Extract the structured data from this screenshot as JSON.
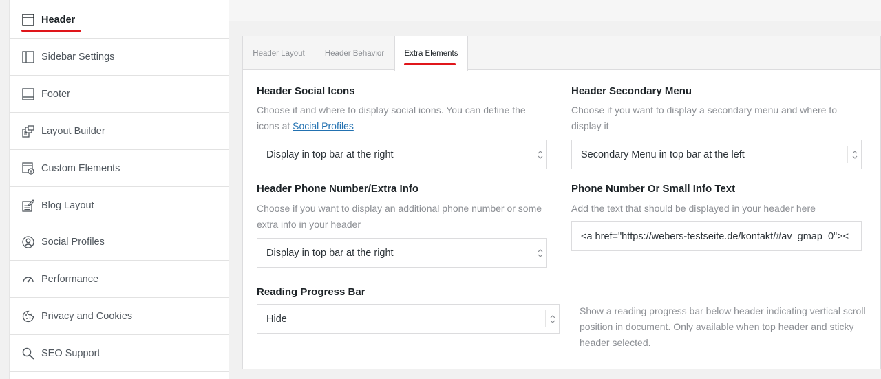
{
  "sidebar": {
    "items": [
      {
        "label": "Header",
        "icon": "header-layout-icon"
      },
      {
        "label": "Sidebar Settings",
        "icon": "sidebar-layout-icon"
      },
      {
        "label": "Footer",
        "icon": "footer-layout-icon"
      },
      {
        "label": "Layout Builder",
        "icon": "layout-builder-icon"
      },
      {
        "label": "Custom Elements",
        "icon": "custom-elements-icon"
      },
      {
        "label": "Blog Layout",
        "icon": "blog-edit-icon"
      },
      {
        "label": "Social Profiles",
        "icon": "social-profile-icon"
      },
      {
        "label": "Performance",
        "icon": "speedometer-icon"
      },
      {
        "label": "Privacy and Cookies",
        "icon": "cookie-icon"
      },
      {
        "label": "SEO Support",
        "icon": "search-icon"
      }
    ],
    "active": "Header"
  },
  "tabs": [
    {
      "label": "Header Layout"
    },
    {
      "label": "Header Behavior"
    },
    {
      "label": "Extra Elements"
    }
  ],
  "active_tab": "Extra Elements",
  "fields": {
    "social_icons": {
      "title": "Header Social Icons",
      "desc_prefix": "Choose if and where to display social icons. You can define the icons at",
      "link": "Social Profiles",
      "value": "Display in top bar at the right"
    },
    "secondary_menu": {
      "title": "Header Secondary Menu",
      "desc": "Choose if you want to display a secondary menu and where to display it",
      "value": "Secondary Menu in top bar at the left"
    },
    "phone": {
      "title": "Header Phone Number/Extra Info",
      "desc": "Choose if you want to display an additional phone number or some extra info in your header",
      "value": "Display in top bar at the right"
    },
    "info_text": {
      "title": "Phone Number Or Small Info Text",
      "desc": "Add the text that should be displayed in your header here",
      "value": "<a href=\"https://webers-testseite.de/kontakt/#av_gmap_0\"><"
    },
    "progress_bar": {
      "title": "Reading Progress Bar",
      "value": "Hide",
      "desc": "Show a reading progress bar below header indicating vertical scroll position in document. Only available when top header and sticky header selected."
    }
  },
  "colors": {
    "accent_red": "#e0161b",
    "link": "#2271b1"
  }
}
